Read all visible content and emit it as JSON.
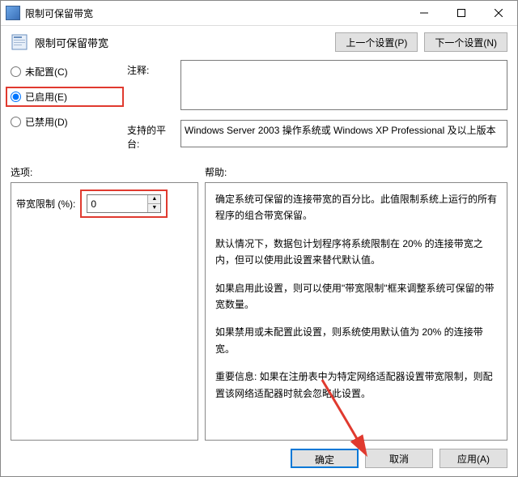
{
  "window": {
    "title": "限制可保留带宽"
  },
  "header": {
    "title": "限制可保留带宽",
    "prev": "上一个设置(P)",
    "next": "下一个设置(N)"
  },
  "radios": {
    "not_configured": "未配置(C)",
    "enabled": "已启用(E)",
    "disabled": "已禁用(D)"
  },
  "fields": {
    "comments_label": "注释:",
    "comments_value": "",
    "platform_label": "支持的平台:",
    "platform_value": "Windows Server 2003 操作系统或 Windows XP Professional 及以上版本"
  },
  "sections": {
    "options": "选项:",
    "help": "帮助:"
  },
  "options": {
    "bandwidth_label": "带宽限制 (%):",
    "bandwidth_value": "0"
  },
  "help": {
    "p1": "确定系统可保留的连接带宽的百分比。此值限制系统上运行的所有程序的组合带宽保留。",
    "p2": "默认情况下，数据包计划程序将系统限制在 20% 的连接带宽之内，但可以使用此设置来替代默认值。",
    "p3": "如果启用此设置，则可以使用\"带宽限制\"框来调整系统可保留的带宽数量。",
    "p4": "如果禁用或未配置此设置，则系统使用默认值为 20% 的连接带宽。",
    "p5": "重要信息: 如果在注册表中为特定网络适配器设置带宽限制，则配置该网络适配器时就会忽略此设置。"
  },
  "footer": {
    "ok": "确定",
    "cancel": "取消",
    "apply": "应用(A)"
  }
}
